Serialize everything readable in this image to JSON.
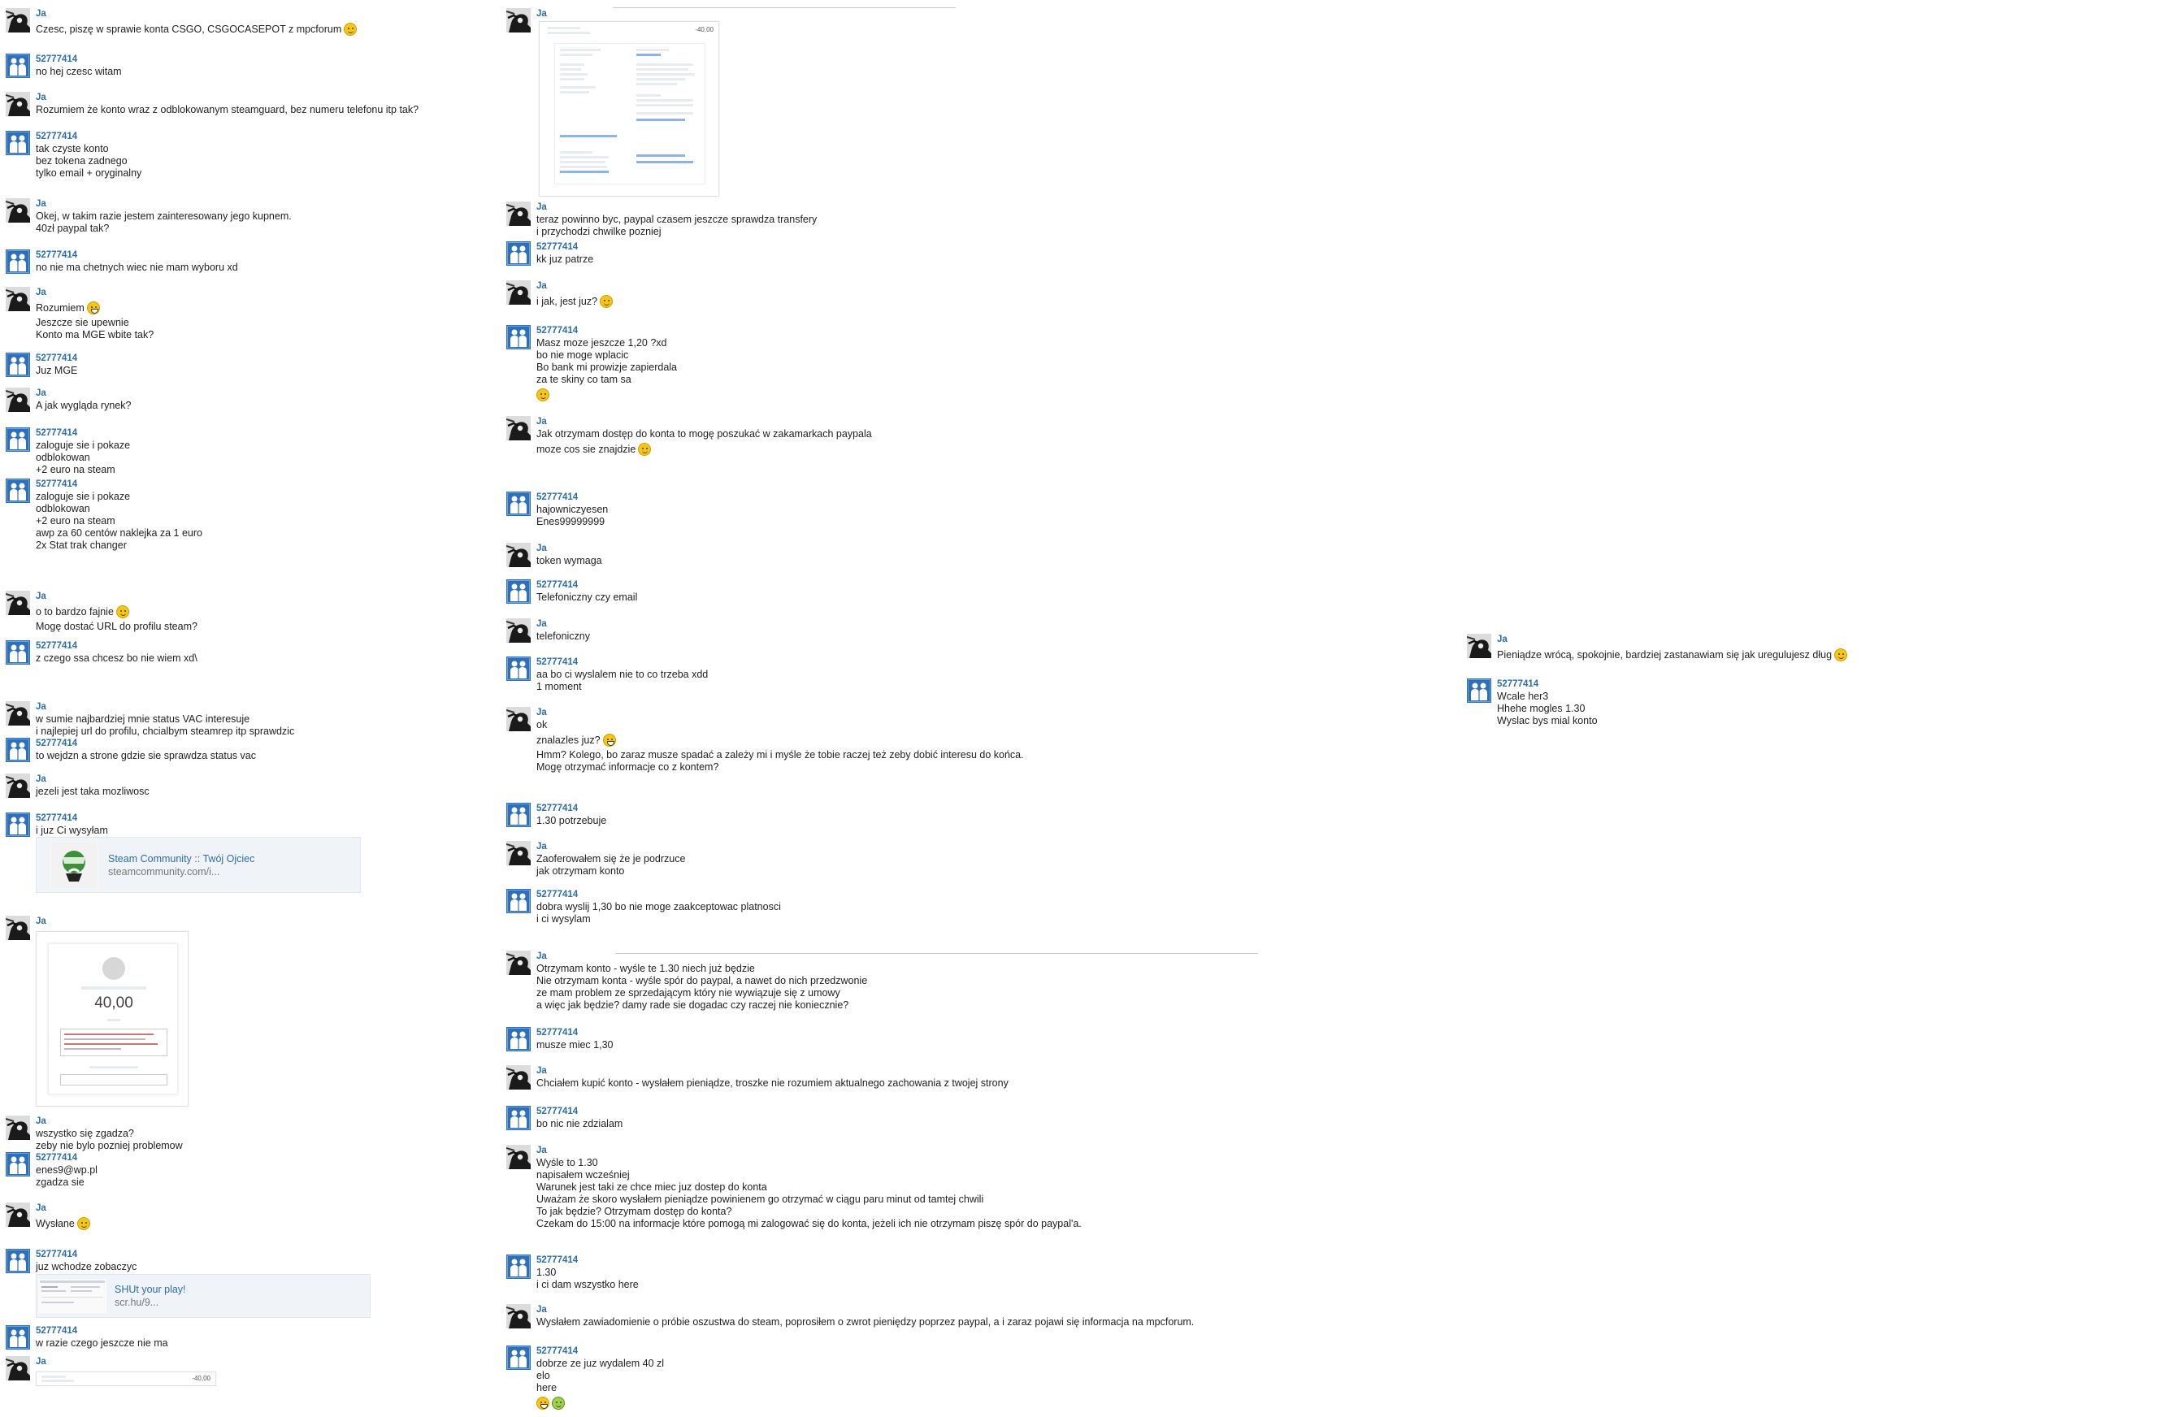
{
  "names": {
    "me": "Ja",
    "other": "52777414"
  },
  "cards": {
    "steam": {
      "title": "Steam Community :: Twój Ojciec",
      "url": "steamcommunity.com/i..."
    },
    "shut": {
      "title": "SHUt your play!",
      "url": "scr.hu/9..."
    }
  },
  "paypal_shot": {
    "amount": "40,00"
  },
  "invoice_shot": {
    "amount": "-40,00"
  },
  "col1": [
    {
      "s": "me",
      "l": [
        "Czesc, piszę w sprawie konta CSGO, CSGOCASEPOT z mpcforum"
      ]
    },
    {
      "s": "other",
      "l": [
        "no hej czesc witam"
      ]
    },
    {
      "s": "me",
      "l": [
        "Rozumiem że konto wraz z odblokowanym steamguard, bez numeru telefonu itp tak?"
      ]
    },
    {
      "s": "other",
      "l": [
        "tak czyste konto",
        "bez tokena zadnego",
        "tylko email + oryginalny"
      ]
    },
    {
      "s": "me",
      "l": [
        "Okej, w takim razie jestem zainteresowany jego kupnem.",
        "40zł paypal tak?"
      ]
    },
    {
      "s": "other",
      "l": [
        "no nie ma chetnych wiec nie mam wyboru xd"
      ]
    },
    {
      "s": "me",
      "l": [
        "Rozumiem",
        "Jeszcze sie upewnie",
        "Konto ma MGE wbite tak?"
      ]
    },
    {
      "s": "other",
      "l": [
        "Juz MGE"
      ]
    },
    {
      "s": "me",
      "l": [
        "A jak wygląda rynek?"
      ]
    },
    {
      "s": "other",
      "l": [
        "zaloguje sie i pokaze",
        "odblokowan",
        "+2 euro na steam"
      ]
    },
    {
      "s": "other",
      "l": [
        "zaloguje sie i pokaze",
        "odblokowan",
        "+2 euro na steam",
        "awp za 60 centów naklejka za 1 euro",
        "2x Stat trak changer"
      ]
    },
    {
      "s": "me",
      "l": [
        "o to bardzo fajnie",
        "Mogę dostać URL do profilu steam?"
      ]
    },
    {
      "s": "other",
      "l": [
        "z czego ssa chcesz bo nie wiem xd\\"
      ]
    },
    {
      "s": "me",
      "l": [
        "w sumie najbardziej mnie status VAC interesuje",
        "i najlepiej url do profilu, chcialbym steamrep itp sprawdzic"
      ]
    },
    {
      "s": "other",
      "l": [
        "to wejdzn a strone gdzie sie sprawdza status vac"
      ]
    },
    {
      "s": "me",
      "l": [
        "jezeli jest taka mozliwosc"
      ]
    },
    {
      "s": "other",
      "l": [
        "i juz Ci wysyłam"
      ]
    },
    {
      "s": "me",
      "l": []
    },
    {
      "s": "me",
      "l": [
        "wszystko się zgadza?",
        "zeby nie bylo pozniej problemow"
      ]
    },
    {
      "s": "other",
      "l": [
        "enes9@wp.pl",
        "zgadza sie"
      ]
    },
    {
      "s": "me",
      "l": [
        "Wysłane"
      ]
    },
    {
      "s": "other",
      "l": [
        "juz wchodze zobaczyc"
      ]
    },
    {
      "s": "other",
      "l": [
        "w razie czego jeszcze nie ma"
      ]
    },
    {
      "s": "me",
      "l": []
    }
  ],
  "col2": [
    {
      "s": "me",
      "l": []
    },
    {
      "s": "me",
      "l": [
        "teraz powinno byc, paypal czasem jeszcze sprawdza transfery",
        "i przychodzi chwilke pozniej"
      ]
    },
    {
      "s": "other",
      "l": [
        "kk juz patrze"
      ]
    },
    {
      "s": "me",
      "l": [
        "i jak, jest juz?"
      ]
    },
    {
      "s": "other",
      "l": [
        "Masz moze jeszcze 1,20 ?xd",
        "bo nie moge wplacic",
        "Bo bank mi prowizje zapierdala",
        "za te skiny co tam sa"
      ]
    },
    {
      "s": "me",
      "l": [
        "Jak otrzymam dostęp do konta to mogę poszukać w zakamarkach paypala",
        "moze cos sie znajdzie"
      ]
    },
    {
      "s": "other",
      "l": [
        "hajowniczyesen",
        "Enes99999999"
      ]
    },
    {
      "s": "me",
      "l": [
        "token wymaga"
      ]
    },
    {
      "s": "other",
      "l": [
        "Telefoniczny czy email"
      ]
    },
    {
      "s": "me",
      "l": [
        "telefoniczny"
      ]
    },
    {
      "s": "other",
      "l": [
        "aa bo ci wyslalem nie to co trzeba xdd",
        "1 moment"
      ]
    },
    {
      "s": "me",
      "l": [
        "ok",
        "znalazles juz?",
        "Hmm? Kolego, bo zaraz musze spadać a zależy mi i myśle że tobie raczej też zeby dobić interesu do końca.",
        "Mogę otrzymać informacje co z kontem?"
      ]
    },
    {
      "s": "other",
      "l": [
        "1.30 potrzebuje"
      ]
    },
    {
      "s": "me",
      "l": [
        "Zaoferowałem się że je podrzuce",
        "jak otrzymam konto"
      ]
    },
    {
      "s": "other",
      "l": [
        "dobra wyslij 1,30 bo nie moge zaakceptowac platnosci",
        "i ci wysylam"
      ]
    },
    {
      "s": "me",
      "l": [
        "Otrzymam konto - wyśle te 1.30 niech już będzie",
        "Nie otrzymam konta - wyśle spór do paypal, a nawet do nich przedzwonie",
        "ze mam problem ze sprzedającym który nie wywiązuje się z umowy",
        "a więc jak będzie? damy rade sie dogadac czy raczej nie koniecznie?"
      ]
    },
    {
      "s": "other",
      "l": [
        "musze miec 1,30"
      ]
    },
    {
      "s": "me",
      "l": [
        "Chciałem kupić konto - wysłałem pieniądze, troszke nie rozumiem aktualnego zachowania z twojej strony"
      ]
    },
    {
      "s": "other",
      "l": [
        "bo nic nie zdzialam"
      ]
    },
    {
      "s": "me",
      "l": [
        "Wyśle to 1.30",
        "napisałem wcześniej",
        "Warunek jest taki ze chce miec juz dostep do konta",
        "Uważam że skoro wysłałem pieniądze powinienem go otrzymać w ciągu paru minut od tamtej chwili",
        "To jak będzie? Otrzymam dostęp do konta?",
        "Czekam do 15:00 na informacje które pomogą mi zalogować się do konta, jeżeli ich nie otrzymam piszę spór do paypal'a."
      ]
    },
    {
      "s": "other",
      "l": [
        "1.30",
        "i ci dam wszystko here"
      ]
    },
    {
      "s": "me",
      "l": [
        "Wysłałem zawiadomienie o próbie oszustwa do steam, poprosiłem o zwrot pieniędzy poprzez paypal, a i zaraz pojawi się informacja na mpcforum."
      ]
    },
    {
      "s": "other",
      "l": [
        "dobrze ze juz wydalem 40 zl",
        "elo",
        "here"
      ]
    }
  ],
  "col3": [
    {
      "s": "me",
      "l": [
        "Pieniądze wrócą, spokojnie, bardziej zastanawiam się jak uregulujesz dług"
      ]
    },
    {
      "s": "other",
      "l": [
        "Wcale her3",
        "Hhehe mogles 1.30",
        "Wyslac bys mial konto"
      ]
    }
  ]
}
